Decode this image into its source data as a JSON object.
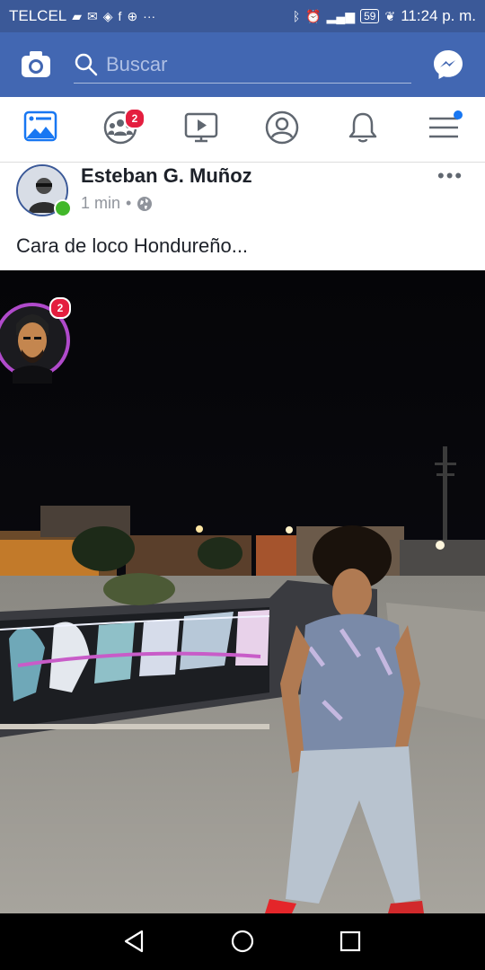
{
  "status_bar": {
    "carrier": "TELCEL",
    "battery": "59",
    "time": "11:24 p. m."
  },
  "app_bar": {
    "search_placeholder": "Buscar",
    "camera_icon": "camera-icon",
    "messenger_icon": "messenger-icon"
  },
  "nav_tabs": [
    {
      "name": "news-feed",
      "icon": "news-feed-icon",
      "badge": ""
    },
    {
      "name": "groups",
      "icon": "groups-icon",
      "badge": "2"
    },
    {
      "name": "watch",
      "icon": "video-icon",
      "badge": ""
    },
    {
      "name": "profile",
      "icon": "profile-icon",
      "badge": ""
    },
    {
      "name": "notifications",
      "icon": "bell-icon",
      "badge": ""
    },
    {
      "name": "menu",
      "icon": "hamburger-icon",
      "badge": ""
    }
  ],
  "post": {
    "author": "Esteban G. Muñoz",
    "time": "1 min",
    "separator": "•",
    "text": "Cara de loco Hondureño..."
  },
  "chat_head": {
    "badge": "2"
  },
  "colors": {
    "facebook_blue": "#4267b2",
    "status_blue": "#3b5998",
    "badge_red": "#e41e3f",
    "online_green": "#42b72a"
  }
}
